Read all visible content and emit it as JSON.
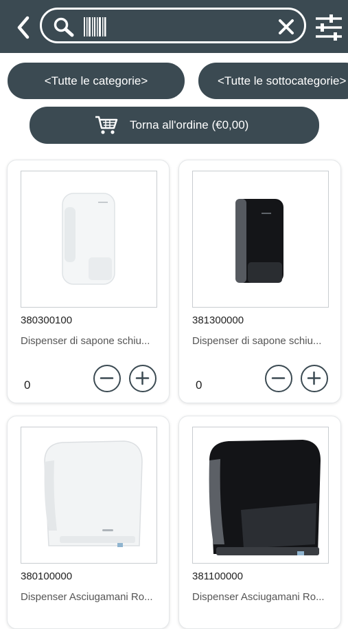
{
  "header": {
    "back_icon": "chevron-left-icon",
    "search": {
      "value": "",
      "placeholder": "",
      "icons": [
        "search-icon",
        "barcode-icon",
        "close-icon"
      ]
    },
    "filter_icon": "sliders-icon"
  },
  "filters": {
    "category_label": "<Tutte le categorie>",
    "subcategory_label": "<Tutte le sottocategorie>"
  },
  "order_button": {
    "label": "Torna all'ordine (€0,00)",
    "icon": "cart-icon"
  },
  "colors": {
    "primary": "#3b4a52",
    "text": "#222222",
    "muted": "#555555",
    "card_border": "#e4e7e9"
  },
  "products": [
    {
      "code": "380300100",
      "description": "Dispenser di sapone schiu...",
      "quantity": "0",
      "image": "white-soap-dispenser"
    },
    {
      "code": "381300000",
      "description": "Dispenser di sapone schiu...",
      "quantity": "0",
      "image": "black-soap-dispenser"
    },
    {
      "code": "380100000",
      "description": "Dispenser Asciugamani Ro...",
      "image": "white-towel-dispenser"
    },
    {
      "code": "381100000",
      "description": "Dispenser Asciugamani Ro...",
      "image": "black-towel-dispenser"
    }
  ]
}
